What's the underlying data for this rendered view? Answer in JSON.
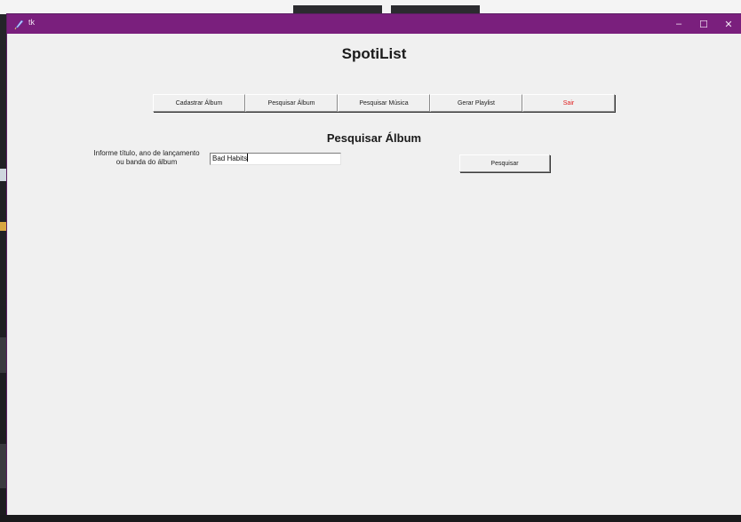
{
  "window": {
    "title": "tk",
    "controls": {
      "minimize": "–",
      "maximize": "☐",
      "close": "✕"
    }
  },
  "app": {
    "title": "SpotiList"
  },
  "menu": {
    "items": [
      {
        "label": "Cadastrar Álbum"
      },
      {
        "label": "Pesquisar Álbum"
      },
      {
        "label": "Pesquisar Música"
      },
      {
        "label": "Gerar Playlist"
      },
      {
        "label": "Sair"
      }
    ]
  },
  "search_form": {
    "section_title": "Pesquisar Álbum",
    "label_line1": "Informe título, ano de lançamento",
    "label_line2": "ou banda do álbum",
    "input_value": "Bad Habits",
    "search_button": "Pesquisar"
  },
  "colors": {
    "titlebar": "#7a1f7d",
    "window_bg": "#f0f0f0",
    "exit_text": "#e02020"
  },
  "icons": {
    "app_icon": "feather-pen-icon"
  }
}
